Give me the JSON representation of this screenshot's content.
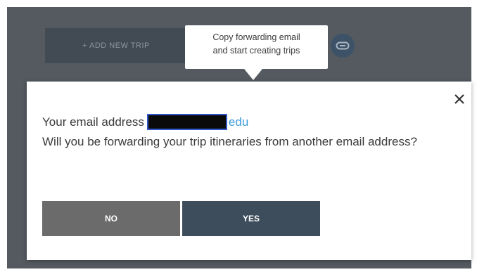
{
  "header": {
    "add_trip_label": "+ ADD NEW TRIP",
    "link_icon": "link-icon"
  },
  "tooltip": {
    "line1": "Copy forwarding email",
    "line2": "and start creating trips"
  },
  "dialog": {
    "close_icon": "close-icon",
    "email_prefix": "Your email address",
    "email_domain": "edu",
    "question": "Will you be forwarding your trip itineraries from another email address?",
    "no_label": "NO",
    "yes_label": "YES"
  },
  "colors": {
    "backdrop": "#545a60",
    "primary_button": "#3e4d5c",
    "secondary_button": "#6b6b6b",
    "link_accent": "#3b9ad9",
    "link_button": "#3d5267"
  }
}
